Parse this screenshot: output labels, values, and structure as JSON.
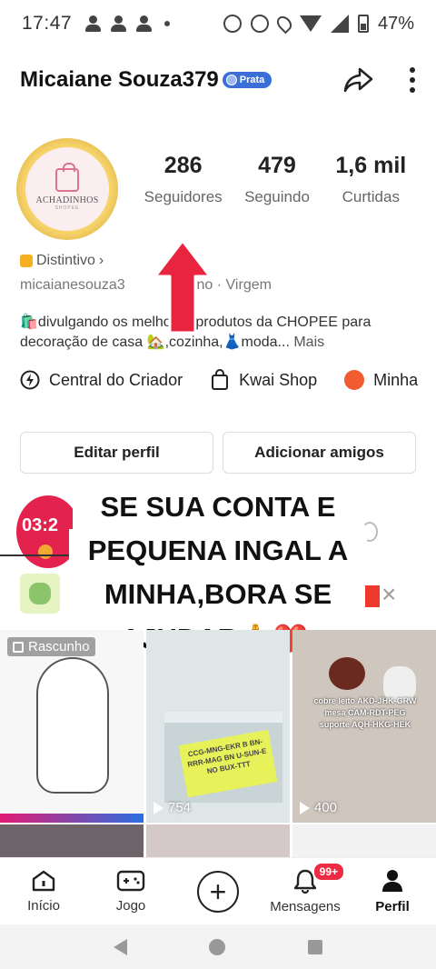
{
  "status_bar": {
    "time": "17:47",
    "battery": "47%"
  },
  "header": {
    "username": "Micaiane Souza379",
    "badge": "Prata"
  },
  "avatar": {
    "logo_text": "ACHADINHOS",
    "logo_sub": "SHOPEE"
  },
  "stats": [
    {
      "value": "286",
      "label": "Seguidores"
    },
    {
      "value": "479",
      "label": "Seguindo"
    },
    {
      "value": "1,6 mil",
      "label": "Curtidas"
    }
  ],
  "distintivo": "Distintivo",
  "meta": {
    "handle": "micaianesouza3",
    "tail": "no · Virgem"
  },
  "bio": {
    "text": "🛍️divulgando os melhores produtos da CHOPEE para decoração de casa 🏡,cozinha,👗moda...",
    "more": "Mais"
  },
  "links": [
    {
      "label": "Central do Criador"
    },
    {
      "label": "Kwai Shop"
    },
    {
      "label": "Minha"
    }
  ],
  "buttons": {
    "edit": "Editar perfil",
    "add_friends": "Adicionar amigos"
  },
  "live": {
    "timer": "03:2"
  },
  "overlay_caption": {
    "line1": "SE SUA CONTA E",
    "line2": "PEQUENA INGAL A",
    "line3": "MINHA,BORA SE",
    "line4": "AJUDAR🙏❤️"
  },
  "grid": {
    "draft_label": "Rascunho",
    "tile2_views": "754",
    "tile3_views": "400",
    "tile2_sticker": "CCG-MNG-EKR B BN-RRR-MAG BN U-SUN-E NO BUX-TTT",
    "tile3_text": "cobre leito AKD-JHK-GRW mesa CAM-RDT-PEG suporte AQH-HKG-HEK"
  },
  "bottom_nav": {
    "inicio": "Início",
    "jogo": "Jogo",
    "mensagens": "Mensagens",
    "mensagens_badge": "99+",
    "perfil": "Perfil"
  },
  "colors": {
    "badge_blue": "#3b6fd8",
    "arrow_red": "#e8243f",
    "badge_red": "#ef2a43"
  }
}
